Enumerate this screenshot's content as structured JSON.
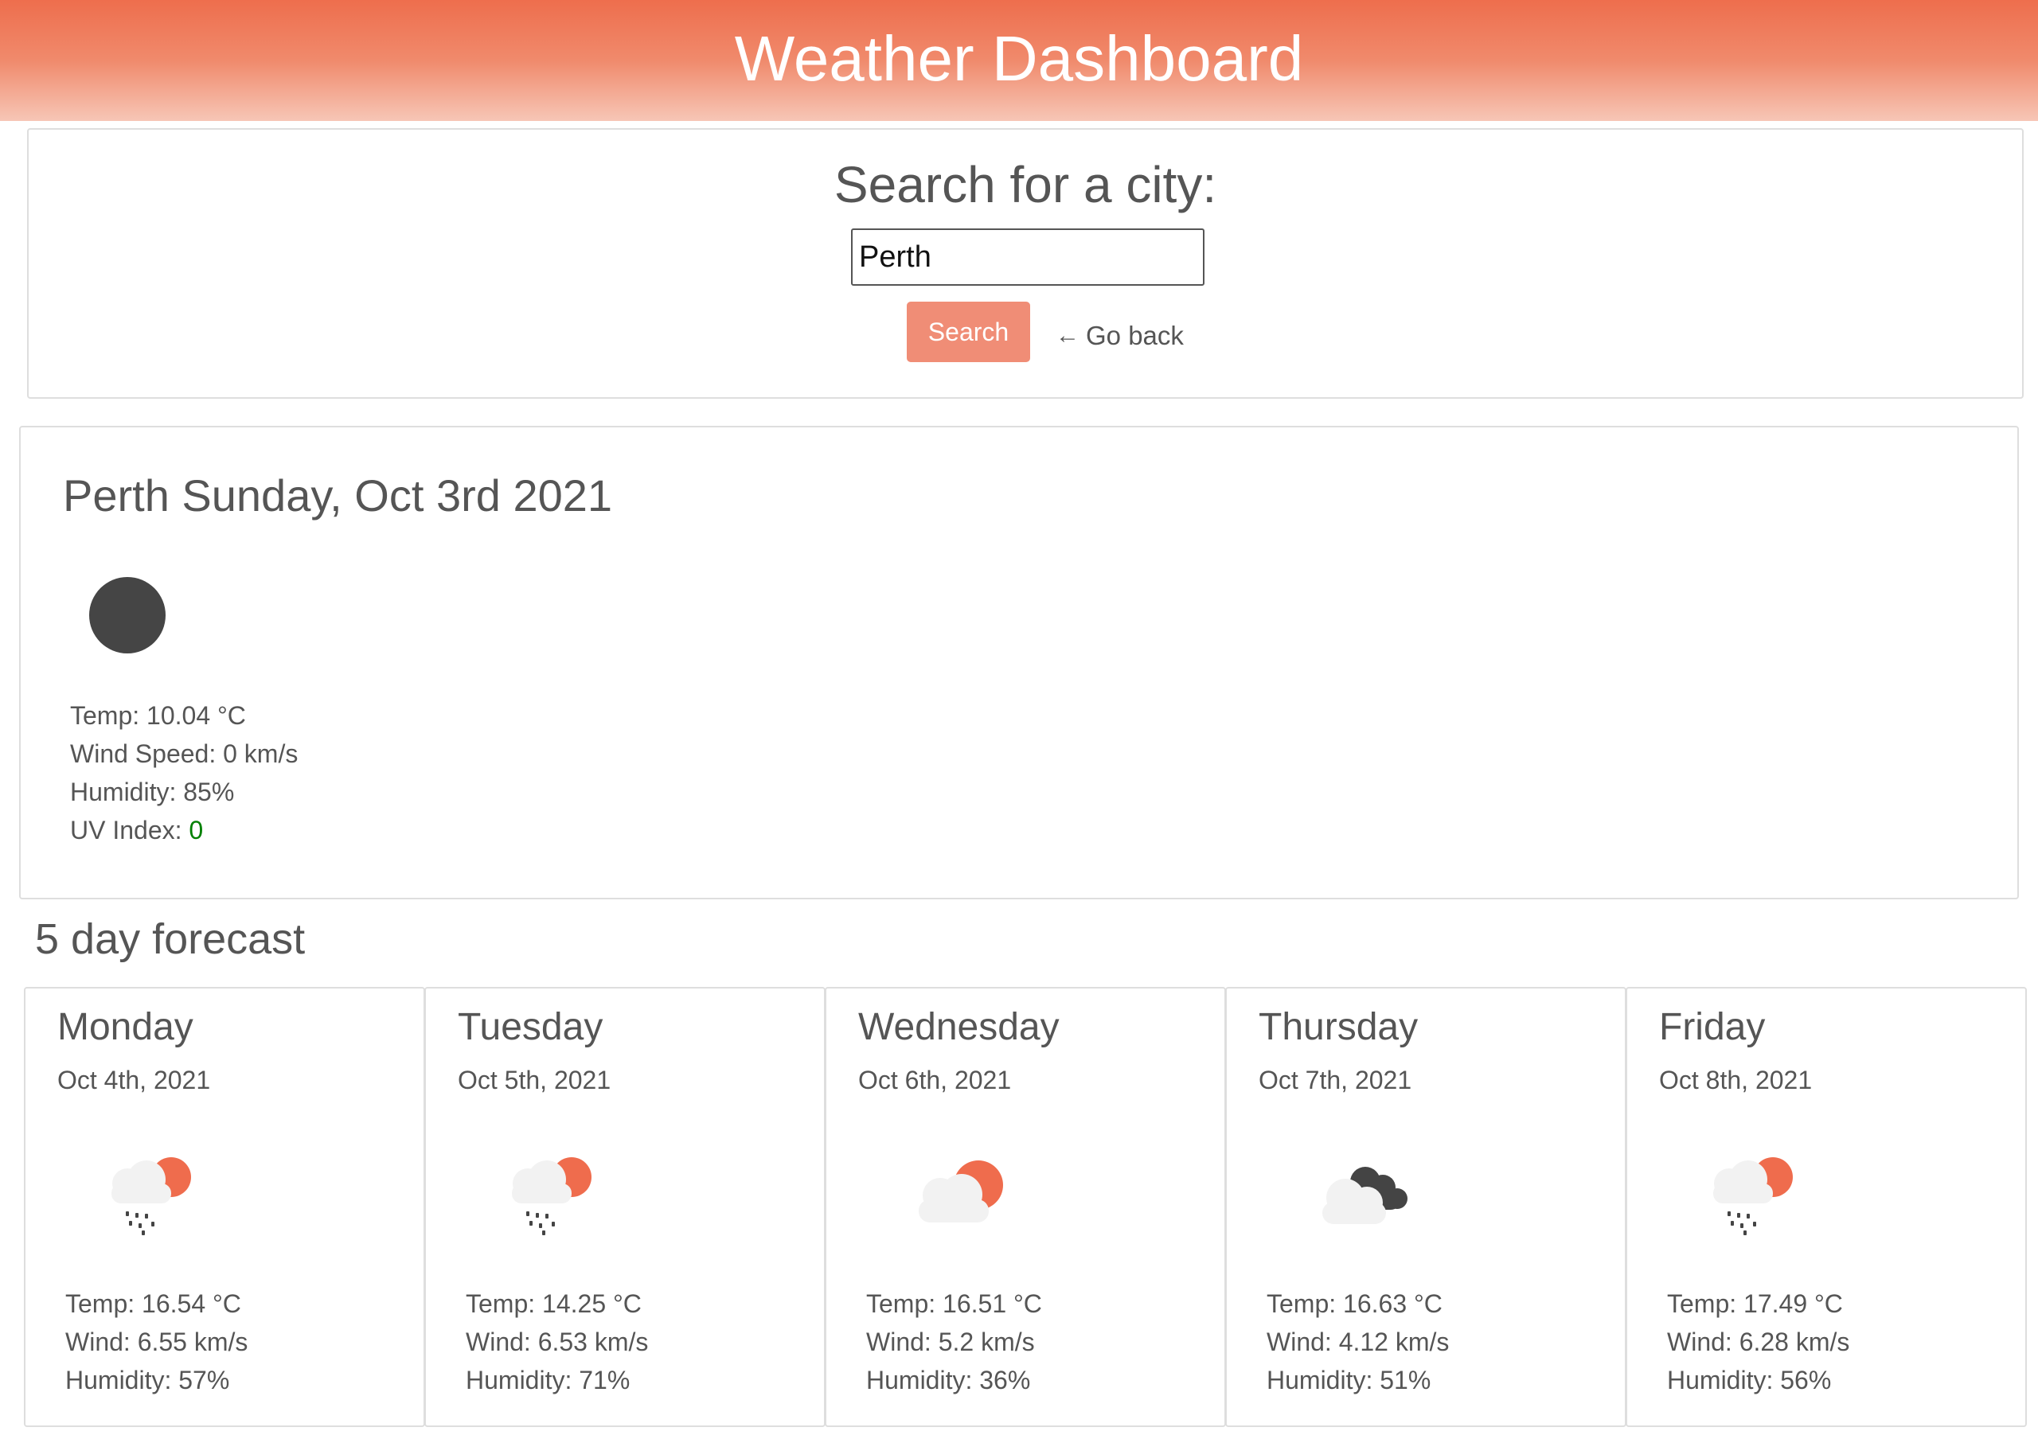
{
  "header": {
    "title": "Weather Dashboard"
  },
  "search": {
    "heading": "Search for a city:",
    "input_value": "Perth",
    "button_label": "Search",
    "go_back_label": "Go back",
    "go_back_icon": "arrow-left-icon"
  },
  "current": {
    "title": "Perth Sunday, Oct 3rd 2021",
    "icon": "clear-night-icon",
    "temp": "Temp: 10.04 °C",
    "wind": "Wind Speed: 0 km/s",
    "humidity": "Humidity: 85%",
    "uv_label": "UV Index: ",
    "uv_value": "0",
    "uv_color": "#008000"
  },
  "forecast": {
    "heading": "5 day forecast",
    "days": [
      {
        "day": "Monday",
        "date": "Oct 4th, 2021",
        "icon": "rain-partly-sunny-icon",
        "temp": "Temp: 16.54 °C",
        "wind": "Wind: 6.55 km/s",
        "humidity": "Humidity: 57%"
      },
      {
        "day": "Tuesday",
        "date": "Oct 5th, 2021",
        "icon": "rain-partly-sunny-icon",
        "temp": "Temp: 14.25 °C",
        "wind": "Wind: 6.53 km/s",
        "humidity": "Humidity: 71%"
      },
      {
        "day": "Wednesday",
        "date": "Oct 6th, 2021",
        "icon": "partly-cloudy-icon",
        "temp": "Temp: 16.51 °C",
        "wind": "Wind: 5.2 km/s",
        "humidity": "Humidity: 36%"
      },
      {
        "day": "Thursday",
        "date": "Oct 7th, 2021",
        "icon": "broken-clouds-icon",
        "temp": "Temp: 16.63 °C",
        "wind": "Wind: 4.12 km/s",
        "humidity": "Humidity: 51%"
      },
      {
        "day": "Friday",
        "date": "Oct 8th, 2021",
        "icon": "rain-partly-sunny-icon",
        "temp": "Temp: 17.49 °C",
        "wind": "Wind: 6.28 km/s",
        "humidity": "Humidity: 56%"
      }
    ]
  },
  "colors": {
    "header_top": "#ee6e4d",
    "header_bottom": "#f7c6b6",
    "button": "#f08d76",
    "sun": "#ef6c4d",
    "cloud": "#f2f2f2",
    "dark_cloud": "#444444",
    "night_disc": "#454545"
  }
}
